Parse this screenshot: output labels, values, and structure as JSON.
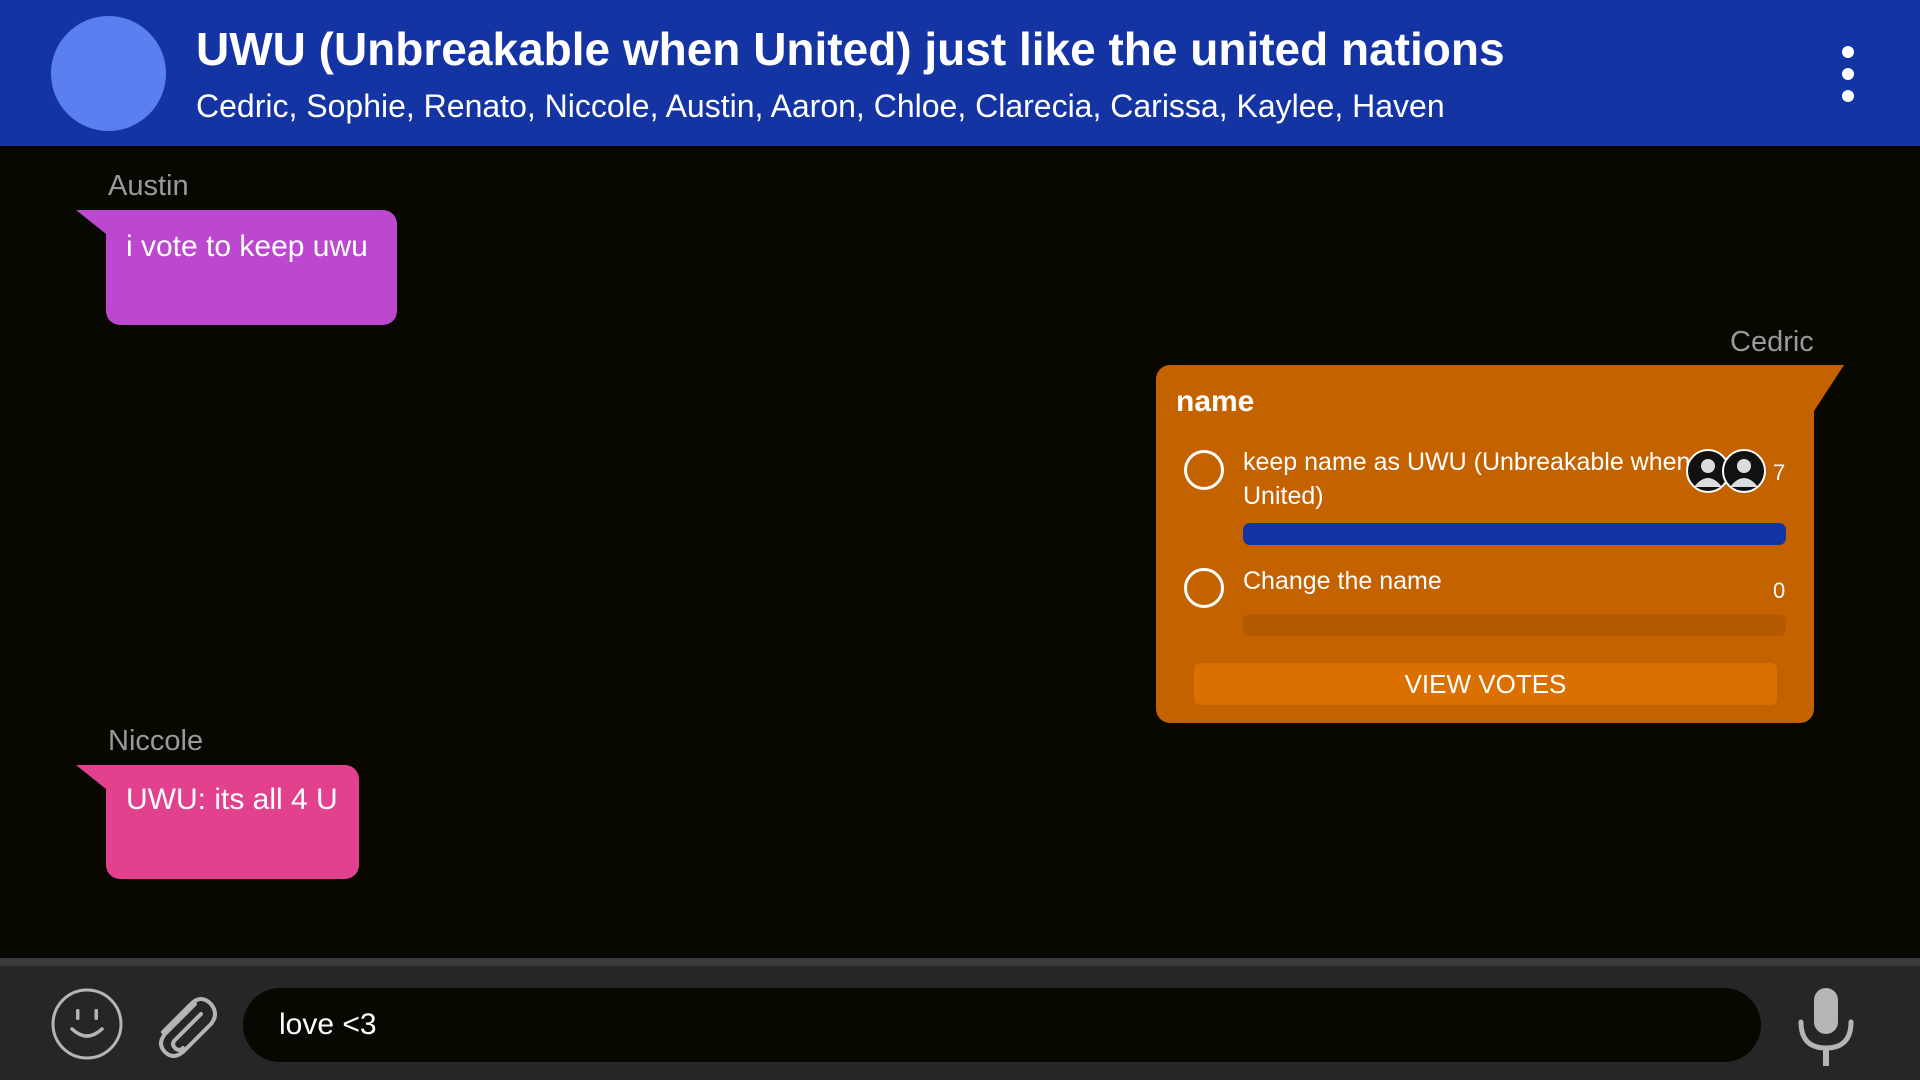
{
  "header": {
    "title": "UWU (Unbreakable when United) just like the united nations",
    "members": "Cedric, Sophie, Renato, Niccole, Austin, Aaron, Chloe, Clarecia, Carissa, Kaylee, Haven",
    "menu_icon": "more-vertical-icon"
  },
  "messages": [
    {
      "sender": "Austin",
      "text": "i vote to keep uwu",
      "color": "#bb48cf"
    },
    {
      "sender": "Niccole",
      "text": "UWU: its all 4 U",
      "color": "#e2418e"
    }
  ],
  "poll": {
    "sender": "Cedric",
    "title": "name",
    "color": "#c46200",
    "options": [
      {
        "label": "keep name as UWU (Unbreakable when United)",
        "count": "7",
        "fill_fraction": 1.0
      },
      {
        "label": "Change the name",
        "count": "0",
        "fill_fraction": 0.0
      }
    ],
    "view_votes_label": "VIEW VOTES"
  },
  "composer": {
    "input_value": "love <3",
    "emoji_icon": "smiley-icon",
    "attach_icon": "paperclip-icon",
    "mic_icon": "microphone-icon"
  },
  "colors": {
    "header": "#1434a3",
    "background": "#080700",
    "footer": "#262626",
    "bar_fill": "#1434a3"
  }
}
